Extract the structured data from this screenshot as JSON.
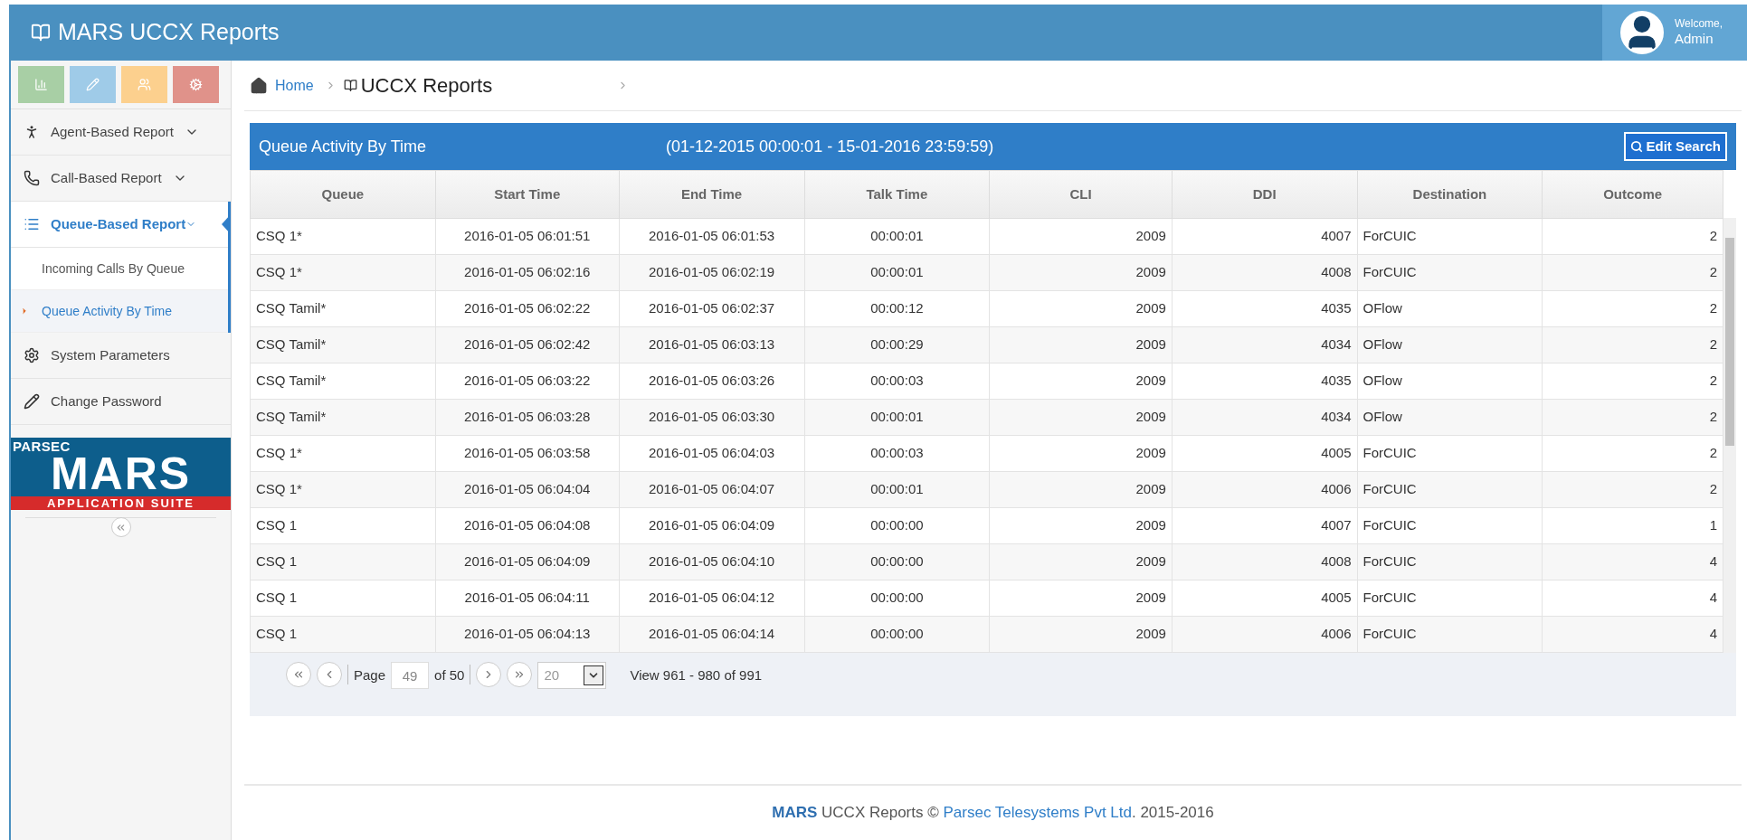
{
  "header": {
    "title": "MARS UCCX Reports",
    "welcome": "Welcome,",
    "user": "Admin"
  },
  "shortcuts": [
    {
      "color": "#a8cfa5"
    },
    {
      "color": "#9fcbe8"
    },
    {
      "color": "#fcd08e"
    },
    {
      "color": "#e0928a"
    }
  ],
  "sidebar": {
    "items": [
      {
        "label": "Agent-Based Report",
        "kind": "group",
        "selected": false,
        "expanded": false
      },
      {
        "label": "Call-Based Report",
        "kind": "group",
        "selected": false,
        "expanded": false
      },
      {
        "label": "Queue-Based Report",
        "kind": "group",
        "selected": true,
        "expanded": true,
        "children": [
          {
            "label": "Incoming Calls By Queue",
            "selected": false
          },
          {
            "label": "Queue Activity By Time",
            "selected": true
          }
        ]
      },
      {
        "label": "System Parameters",
        "kind": "link",
        "selected": false
      },
      {
        "label": "Change Password",
        "kind": "link",
        "selected": false
      }
    ],
    "logo": {
      "top": "PARSEC",
      "main": "MARS",
      "bottom": "APPLICATION SUITE"
    }
  },
  "breadcrumb": {
    "home": "Home",
    "current": "UCCX Reports"
  },
  "panel": {
    "title": "Queue Activity By Time",
    "range": "(01-12-2015 00:00:01 - 15-01-2016 23:59:59)",
    "button": "Edit Search"
  },
  "table": {
    "columns": [
      "Queue",
      "Start Time",
      "End Time",
      "Talk Time",
      "CLI",
      "DDI",
      "Destination",
      "Outcome"
    ],
    "rows": [
      [
        "CSQ 1*",
        "2016-01-05 06:01:51",
        "2016-01-05 06:01:53",
        "00:00:01",
        "2009",
        "4007",
        "ForCUIC",
        "2"
      ],
      [
        "CSQ 1*",
        "2016-01-05 06:02:16",
        "2016-01-05 06:02:19",
        "00:00:01",
        "2009",
        "4008",
        "ForCUIC",
        "2"
      ],
      [
        "CSQ Tamil*",
        "2016-01-05 06:02:22",
        "2016-01-05 06:02:37",
        "00:00:12",
        "2009",
        "4035",
        "OFlow",
        "2"
      ],
      [
        "CSQ Tamil*",
        "2016-01-05 06:02:42",
        "2016-01-05 06:03:13",
        "00:00:29",
        "2009",
        "4034",
        "OFlow",
        "2"
      ],
      [
        "CSQ Tamil*",
        "2016-01-05 06:03:22",
        "2016-01-05 06:03:26",
        "00:00:03",
        "2009",
        "4035",
        "OFlow",
        "2"
      ],
      [
        "CSQ Tamil*",
        "2016-01-05 06:03:28",
        "2016-01-05 06:03:30",
        "00:00:01",
        "2009",
        "4034",
        "OFlow",
        "2"
      ],
      [
        "CSQ 1*",
        "2016-01-05 06:03:58",
        "2016-01-05 06:04:03",
        "00:00:03",
        "2009",
        "4005",
        "ForCUIC",
        "2"
      ],
      [
        "CSQ 1*",
        "2016-01-05 06:04:04",
        "2016-01-05 06:04:07",
        "00:00:01",
        "2009",
        "4006",
        "ForCUIC",
        "2"
      ],
      [
        "CSQ 1",
        "2016-01-05 06:04:08",
        "2016-01-05 06:04:09",
        "00:00:00",
        "2009",
        "4007",
        "ForCUIC",
        "1"
      ],
      [
        "CSQ 1",
        "2016-01-05 06:04:09",
        "2016-01-05 06:04:10",
        "00:00:00",
        "2009",
        "4008",
        "ForCUIC",
        "4"
      ],
      [
        "CSQ 1",
        "2016-01-05 06:04:11",
        "2016-01-05 06:04:12",
        "00:00:00",
        "2009",
        "4005",
        "ForCUIC",
        "4"
      ],
      [
        "CSQ 1",
        "2016-01-05 06:04:13",
        "2016-01-05 06:04:14",
        "00:00:00",
        "2009",
        "4006",
        "ForCUIC",
        "4"
      ]
    ]
  },
  "pager": {
    "page_label": "Page",
    "page": "49",
    "of": "of 50",
    "page_size": "20",
    "view": "View 961 - 980 of 991"
  },
  "footer": {
    "brand": "MARS",
    "text": " UCCX Reports © ",
    "company": "Parsec Telesystems Pvt Ltd",
    "suffix": ". 2015-2016"
  }
}
